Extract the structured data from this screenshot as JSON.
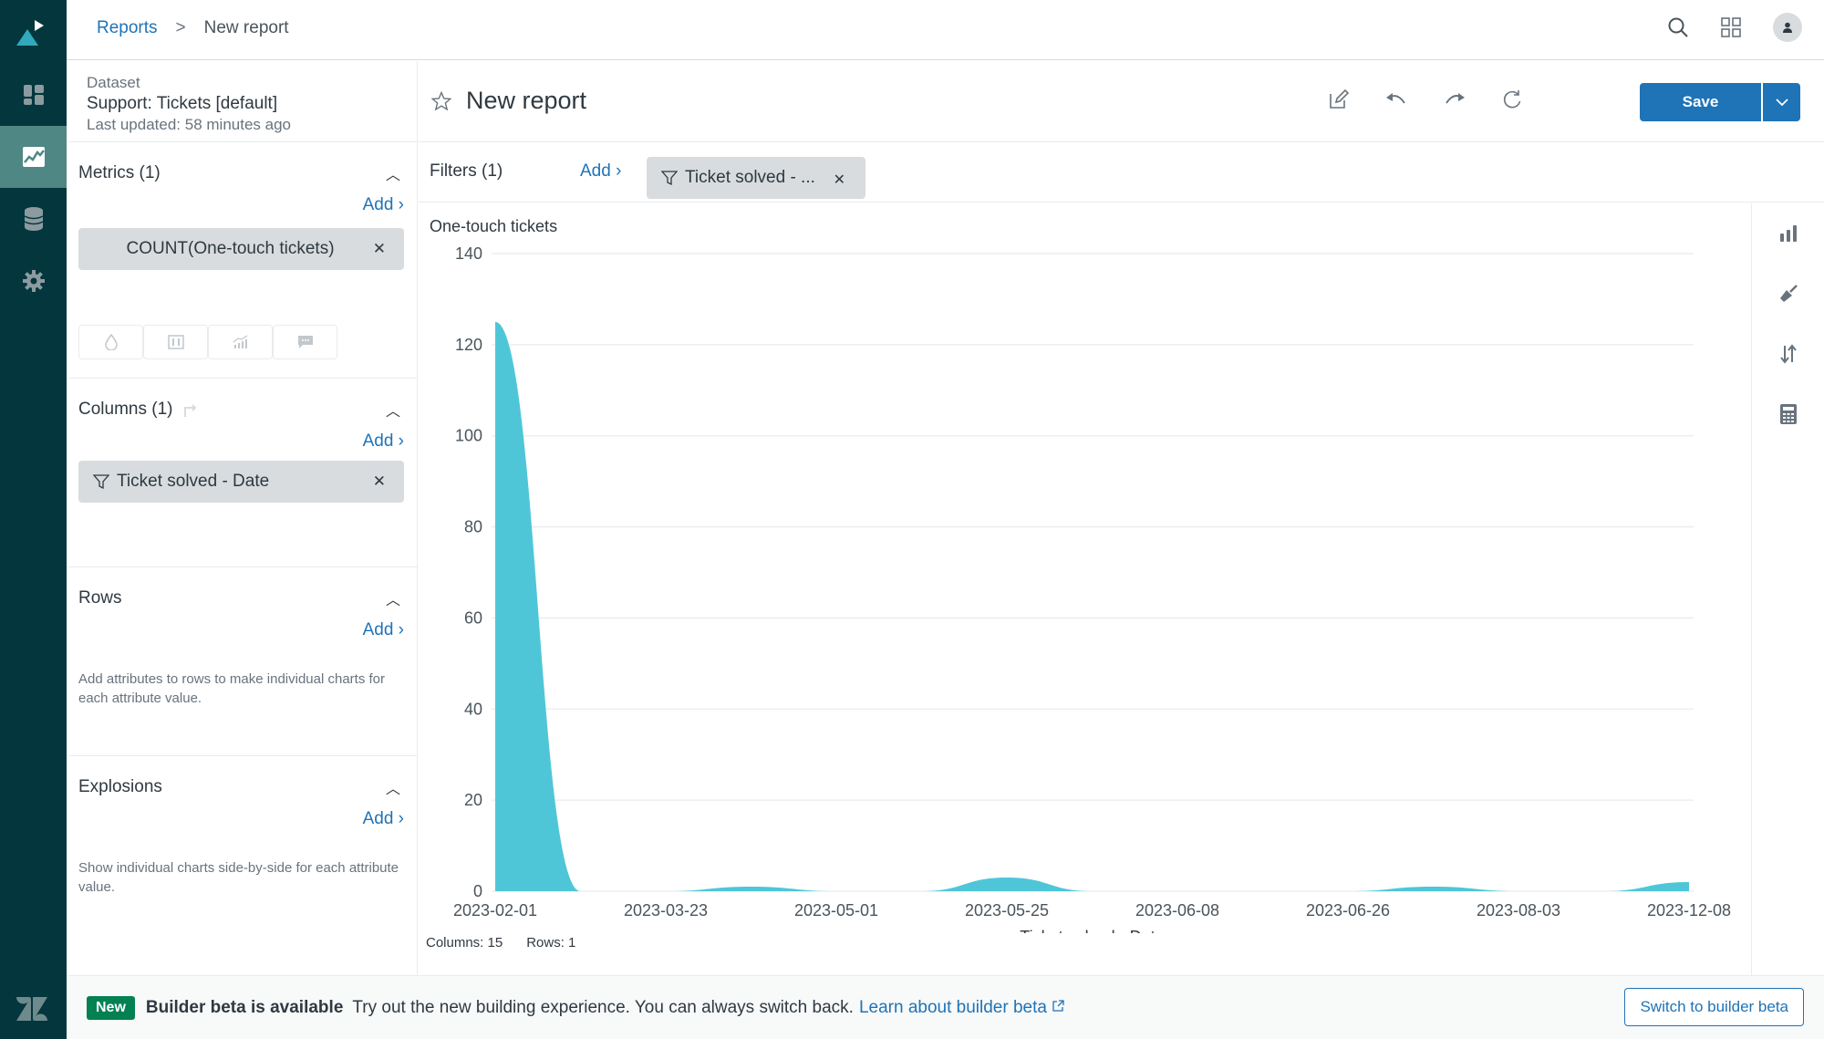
{
  "nav": {
    "items": [
      {
        "name": "dashboard",
        "active": false
      },
      {
        "name": "reports",
        "active": true
      },
      {
        "name": "datasets",
        "active": false
      },
      {
        "name": "admin",
        "active": false
      }
    ]
  },
  "header": {
    "breadcrumb_root": "Reports",
    "breadcrumb_sep": ">",
    "breadcrumb_current": "New report"
  },
  "dataset": {
    "label": "Dataset",
    "name": "Support: Tickets [default]",
    "updated": "Last updated: 58 minutes ago"
  },
  "sections": {
    "metrics": {
      "title": "Metrics (1)",
      "add": "Add ›",
      "pill": "COUNT(One-touch tickets)"
    },
    "columns": {
      "title": "Columns (1)",
      "add": "Add ›",
      "pill": "Ticket solved - Date"
    },
    "rows": {
      "title": "Rows",
      "add": "Add ›",
      "help": "Add attributes to rows to make individual charts for each attribute value."
    },
    "explosions": {
      "title": "Explosions",
      "add": "Add ›",
      "help": "Show individual charts side-by-side for each attribute value."
    }
  },
  "report": {
    "title": "New report",
    "save_label": "Save"
  },
  "filters": {
    "label": "Filters (1)",
    "add": "Add ›",
    "pill": "Ticket solved - ..."
  },
  "stats": {
    "columns": "Columns: 15",
    "rows": "Rows: 1"
  },
  "banner": {
    "badge": "New",
    "headline": "Builder beta is available",
    "message": "Try out the new building experience. You can always switch back.",
    "link": "Learn about builder beta",
    "button": "Switch to builder beta"
  },
  "colors": {
    "rail": "#03363d",
    "accent": "#1f73b7",
    "area": "#4fc6d8",
    "new_badge": "#038153"
  },
  "chart_data": {
    "type": "area",
    "title": "One-touch tickets",
    "xlabel": "Ticket solved - Date",
    "ylabel": "One-touch tickets",
    "ylim": [
      0,
      140
    ],
    "yticks": [
      0,
      20,
      40,
      60,
      80,
      100,
      120,
      140
    ],
    "grid": true,
    "legend": "none",
    "x_tick_labels": [
      "2023-02-01",
      "2023-03-23",
      "2023-05-01",
      "2023-05-25",
      "2023-06-08",
      "2023-06-26",
      "2023-08-03",
      "2023-12-08"
    ],
    "x_tick_every": 2,
    "column_count": 15,
    "values": [
      125,
      0,
      0,
      1,
      0,
      0,
      3,
      0,
      0,
      0,
      0,
      1,
      0,
      0,
      2
    ]
  }
}
